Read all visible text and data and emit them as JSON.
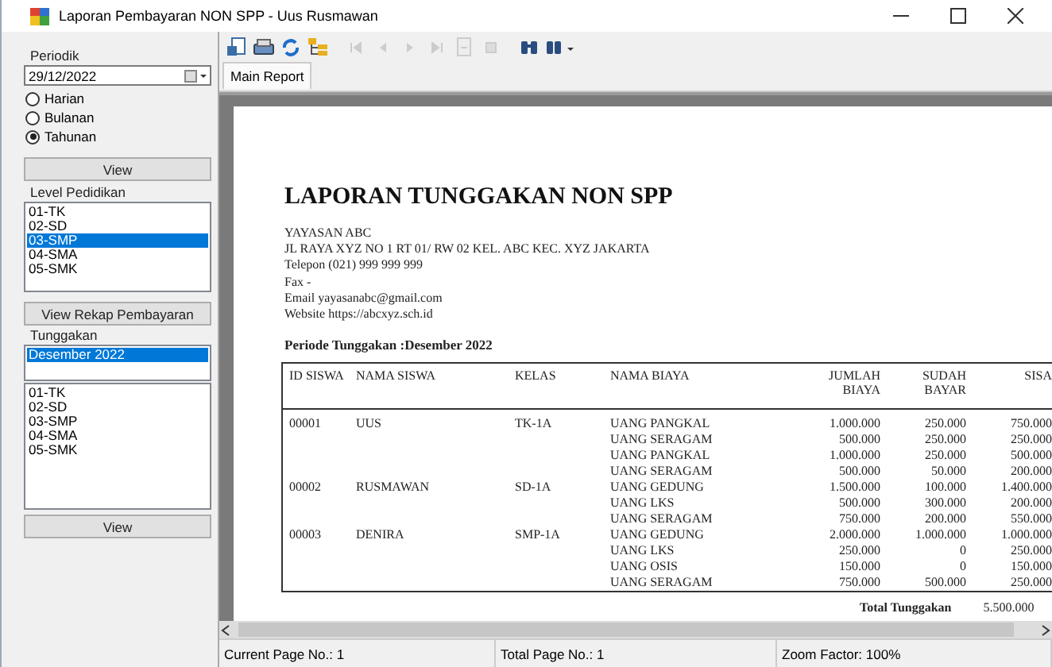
{
  "window": {
    "title": "Laporan Pembayaran NON SPP - Uus Rusmawan"
  },
  "sidebar": {
    "periodik_label": "Periodik",
    "date_field": {
      "value": "29/12/2022"
    },
    "periods": [
      {
        "label": "Harian",
        "selected": false
      },
      {
        "label": "Bulanan",
        "selected": false
      },
      {
        "label": "Tahunan",
        "selected": true
      }
    ],
    "view_button": "View",
    "level_label": "Level Pedidikan",
    "levels": [
      {
        "label": "01-TK",
        "selected": false
      },
      {
        "label": "02-SD",
        "selected": false
      },
      {
        "label": "03-SMP",
        "selected": true
      },
      {
        "label": "04-SMA",
        "selected": false
      },
      {
        "label": "05-SMK",
        "selected": false
      }
    ],
    "rekap_button": "View Rekap Pembayaran",
    "tunggakan_label": "Tunggakan",
    "months": [
      {
        "label": "Desember 2022",
        "selected": true
      }
    ],
    "levels_2": [
      {
        "label": "01-TK",
        "selected": false
      },
      {
        "label": "02-SD",
        "selected": false
      },
      {
        "label": "03-SMP",
        "selected": false
      },
      {
        "label": "04-SMA",
        "selected": false
      },
      {
        "label": "05-SMK",
        "selected": false
      }
    ],
    "view_button_2": "View"
  },
  "toolbar": [
    {
      "kind": "export",
      "disabled": false
    },
    {
      "kind": "print",
      "disabled": false
    },
    {
      "kind": "refresh",
      "disabled": false
    },
    {
      "kind": "tree",
      "disabled": false
    },
    {
      "kind": "first",
      "disabled": true
    },
    {
      "kind": "prev",
      "disabled": true
    },
    {
      "kind": "next",
      "disabled": true
    },
    {
      "kind": "last",
      "disabled": true
    },
    {
      "kind": "goto",
      "disabled": true
    },
    {
      "kind": "stop",
      "disabled": true
    },
    {
      "kind": "find",
      "disabled": false
    },
    {
      "kind": "zoom",
      "disabled": false
    }
  ],
  "tabs": [
    {
      "label": "Main Report",
      "selected": true
    }
  ],
  "report": {
    "title": "LAPORAN TUNGGAKAN NON SPP",
    "header_lines": [
      "YAYASAN ABC",
      "JL RAYA XYZ NO 1 RT 01/ RW 02 KEL. ABC KEC. XYZ JAKARTA",
      "Telepon (021) 999 999 999",
      "Fax -",
      "Email yayasanabc@gmail.com",
      "Website https://abcxyz.sch.id"
    ],
    "period": "Periode Tunggakan :Desember 2022",
    "table": {
      "columns": [
        "ID SISWA",
        "NAMA SISWA",
        "KELAS",
        "NAMA BIAYA",
        "JUMLAH BIAYA",
        "SUDAH BAYAR",
        "SISA"
      ],
      "rows": [
        {
          "id": "00001",
          "name": "UUS",
          "class": "TK-1A",
          "fee": "UANG PANGKAL",
          "amount": "1.000.000",
          "paid": "250.000",
          "rest": "750.000"
        },
        {
          "fee": "UANG SERAGAM",
          "amount": "500.000",
          "paid": "250.000",
          "rest": "250.000"
        },
        {
          "fee": "UANG PANGKAL",
          "amount": "1.000.000",
          "paid": "250.000",
          "rest": "500.000"
        },
        {
          "fee": "UANG SERAGAM",
          "amount": "500.000",
          "paid": "50.000",
          "rest": "200.000"
        },
        {
          "id": "00002",
          "name": "RUSMAWAN",
          "class": "SD-1A",
          "fee": "UANG GEDUNG",
          "amount": "1.500.000",
          "paid": "100.000",
          "rest": "1.400.000"
        },
        {
          "fee": "UANG LKS",
          "amount": "500.000",
          "paid": "300.000",
          "rest": "200.000"
        },
        {
          "fee": "UANG SERAGAM",
          "amount": "750.000",
          "paid": "200.000",
          "rest": "550.000"
        },
        {
          "id": "00003",
          "name": "DENIRA",
          "class": "SMP-1A",
          "fee": "UANG GEDUNG",
          "amount": "2.000.000",
          "paid": "1.000.000",
          "rest": "1.000.000"
        },
        {
          "fee": "UANG LKS",
          "amount": "250.000",
          "paid": "0",
          "rest": "250.000"
        },
        {
          "fee": "UANG OSIS",
          "amount": "150.000",
          "paid": "0",
          "rest": "150.000"
        },
        {
          "fee": "UANG SERAGAM",
          "amount": "750.000",
          "paid": "500.000",
          "rest": "250.000"
        }
      ]
    },
    "total_label": "Total Tunggakan",
    "total_value": "5.500.000"
  },
  "status_bar": [
    "Current Page No.: 1",
    "Total Page No.: 1",
    "Zoom Factor: 100%"
  ]
}
